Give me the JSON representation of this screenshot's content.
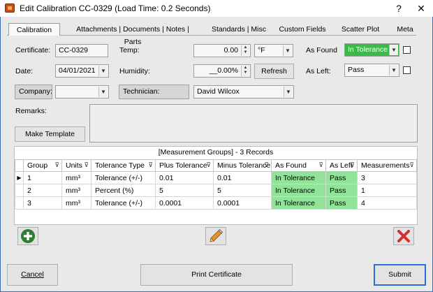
{
  "window": {
    "title": "Edit Calibration CC-0329 (Load Time: 0.2 Seconds)",
    "help": "?",
    "close": "✕"
  },
  "tabs": [
    {
      "label": "Calibration"
    },
    {
      "label": "Attachments | Documents | Notes | Parts"
    },
    {
      "label": "Standards | Misc"
    },
    {
      "label": "Custom Fields"
    },
    {
      "label": "Scatter Plot"
    },
    {
      "label": "Meta"
    }
  ],
  "form": {
    "certificate_label": "Certificate:",
    "certificate_value": "CC-0329",
    "date_label": "Date:",
    "date_value": "04/01/2021",
    "company_label": "Company:",
    "company_value": "",
    "temp_label": "Temp:",
    "temp_value": "0.00",
    "temp_unit": "°F",
    "humidity_label": "Humidity:",
    "humidity_value": "__0.00%",
    "refresh_label": "Refresh",
    "technician_label": "Technician:",
    "technician_value": "David Wilcox",
    "as_found_label": "As Found",
    "as_found_value": "In Tolerance",
    "as_left_label": "As Left:",
    "as_left_value": "Pass",
    "remarks_label": "Remarks:",
    "remarks_value": "",
    "make_template_label": "Make Template"
  },
  "grid": {
    "caption": "[Measurement Groups] - 3 Records",
    "columns": [
      "Group",
      "Units",
      "Tolerance Type",
      "Plus Tolerance",
      "Minus Tolerance",
      "As Found",
      "As Left",
      "Measurements"
    ],
    "rows": [
      [
        "1",
        "mm³",
        "Tolerance (+/-)",
        "0.01",
        "0.01",
        "In Tolerance",
        "Pass",
        "3"
      ],
      [
        "2",
        "mm³",
        "Percent (%)",
        "5",
        "5",
        "In Tolerance",
        "Pass",
        "1"
      ],
      [
        "3",
        "mm³",
        "Tolerance (+/-)",
        "0.0001",
        "0.0001",
        "In Tolerance",
        "Pass",
        "4"
      ]
    ],
    "current_row_marker": "▶"
  },
  "footer": {
    "cancel_label": "Cancel",
    "print_label": "Print Certificate",
    "submit_label": "Submit"
  },
  "colors": {
    "as_found_green": "#92e39a",
    "add_green": "#2e7d32",
    "delete_red": "#d32f2f"
  }
}
